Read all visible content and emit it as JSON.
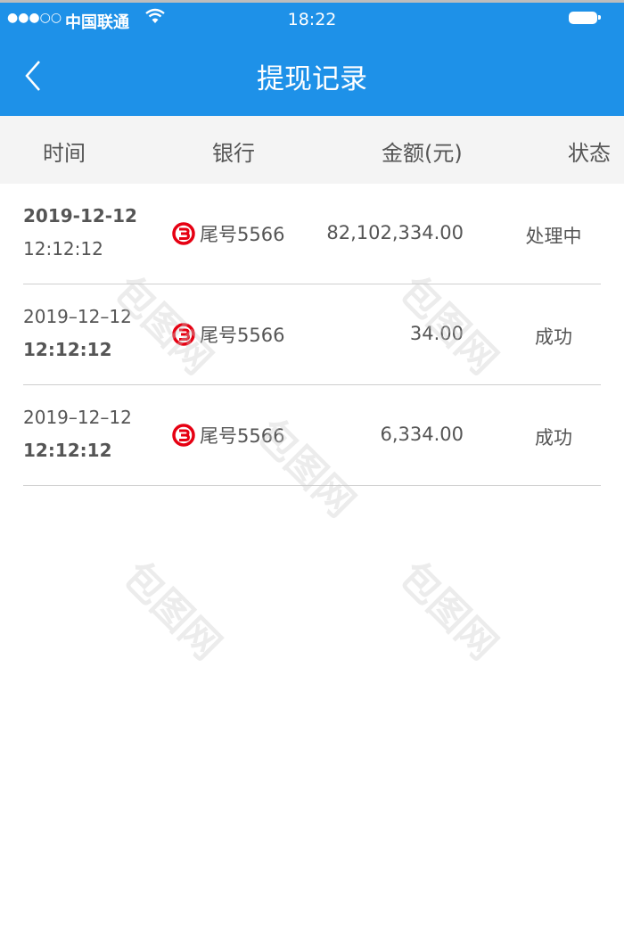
{
  "status_bar": {
    "signal": "●●●○○",
    "carrier": "中国联通",
    "time": "18:22",
    "wifi_icon": "wifi-icon",
    "battery_icon": "battery-icon"
  },
  "nav": {
    "back_icon": "chevron-left-icon",
    "title": "提现记录"
  },
  "table": {
    "columns": [
      "时间",
      "银行",
      "金额(元)",
      "状态"
    ],
    "rows": [
      {
        "date": "2019-12-12",
        "time": "12:12:12",
        "bank_icon": "bank-logo-icon",
        "bank": "尾号5566",
        "amount": "82,102,334.00",
        "status": "处理中",
        "date_bold": true
      },
      {
        "date": "2019–12–12",
        "time": "12:12:12",
        "bank_icon": "bank-logo-icon",
        "bank": "尾号5566",
        "amount": "34.00",
        "status": "成功",
        "date_bold": false
      },
      {
        "date": "2019–12–12",
        "time": "12:12:12",
        "bank_icon": "bank-logo-icon",
        "bank": "尾号5566",
        "amount": "6,334.00",
        "status": "成功",
        "date_bold": false
      }
    ]
  },
  "colors": {
    "primary": "#1e91e8",
    "bank_logo": "#e60012",
    "header_bg": "#f4f4f4"
  },
  "watermark": "包图网"
}
